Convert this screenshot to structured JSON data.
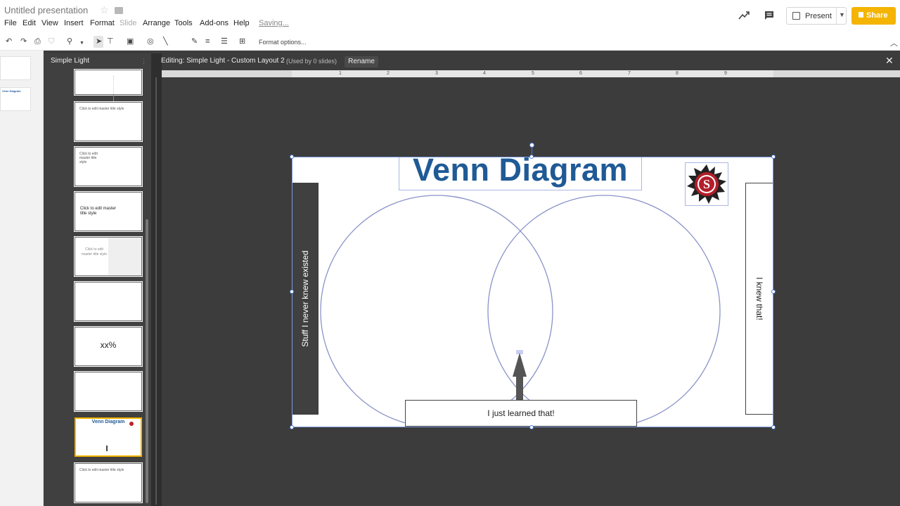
{
  "app": {
    "doc_title": "Untitled presentation",
    "save_status": "Saving..."
  },
  "menu": {
    "file": "File",
    "edit": "Edit",
    "view": "View",
    "insert": "Insert",
    "format": "Format",
    "slide": "Slide",
    "arrange": "Arrange",
    "tools": "Tools",
    "addons": "Add-ons",
    "help": "Help"
  },
  "header": {
    "present_label": "Present",
    "share_label": "Share"
  },
  "toolbar": {
    "format_options": "Format options..."
  },
  "layout_panel": {
    "theme_name": "Simple Light",
    "thumbnails": [
      {
        "text": ""
      },
      {
        "text": "Click to edit master title style"
      },
      {
        "text": "Click to edit master title style"
      },
      {
        "text": "Click to edit master title style"
      },
      {
        "text": "Click to edit master title style"
      },
      {
        "text": ""
      },
      {
        "text": "xx%"
      },
      {
        "text": ""
      },
      {
        "text": "Venn Diagram"
      },
      {
        "text": "Click to edit master title style"
      }
    ]
  },
  "editor": {
    "editing_label": "Editing: Simple Light - Custom Layout 2",
    "used_label": "(Used by 0 slides)",
    "rename_label": "Rename"
  },
  "ruler": {
    "ticks": [
      "1",
      "2",
      "3",
      "4",
      "5",
      "6",
      "7",
      "8",
      "9"
    ]
  },
  "slide": {
    "title": "Venn Diagram",
    "left_label": "Stuff I never knew existed",
    "right_label": "I knew that!",
    "bottom_label": "I just learned that!"
  },
  "colors": {
    "title_blue": "#1f5a96",
    "share_yellow": "#f4b400",
    "dark_bg": "#3c3c3c",
    "selection_blue": "#4a7bd8"
  }
}
